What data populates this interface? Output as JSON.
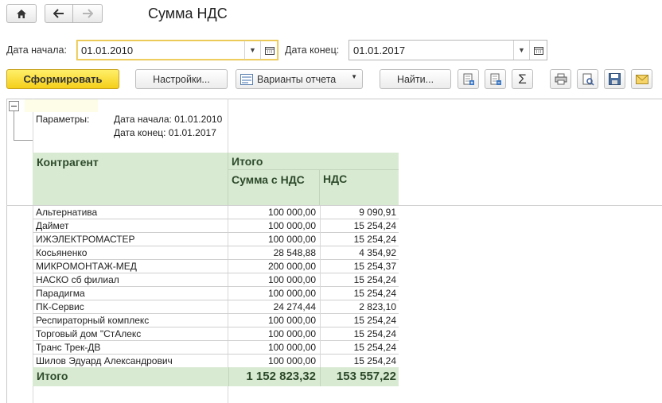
{
  "window": {
    "title": "Сумма НДС"
  },
  "nav": {
    "home_icon": "home-icon",
    "back_icon": "arrow-left-icon",
    "forward_icon": "arrow-right-icon"
  },
  "filters": {
    "start_label": "Дата начала:",
    "start_value": "01.01.2010",
    "end_label": "Дата конец:",
    "end_value": "01.01.2017"
  },
  "toolbar": {
    "generate_label": "Сформировать",
    "settings_label": "Настройки...",
    "variants_label": "Варианты отчета",
    "find_label": "Найти...",
    "sum_glyph": "Σ"
  },
  "report": {
    "params_label": "Параметры:",
    "param_start": "Дата начала: 01.01.2010",
    "param_end": "Дата конец: 01.01.2017",
    "col_contragent": "Контрагент",
    "col_total": "Итого",
    "col_sum": "Сумма с НДС",
    "col_vat": "НДС",
    "rows": [
      {
        "name": "Альтернатива",
        "sum": "100 000,00",
        "vat": "9 090,91"
      },
      {
        "name": "Даймет",
        "sum": "100 000,00",
        "vat": "15 254,24"
      },
      {
        "name": "ИЖЭЛЕКТРОМАСТЕР",
        "sum": "100 000,00",
        "vat": "15 254,24"
      },
      {
        "name": "Косьяненко",
        "sum": "28 548,88",
        "vat": "4 354,92"
      },
      {
        "name": "МИКРОМОНТАЖ-МЕД",
        "sum": "200 000,00",
        "vat": "15 254,37"
      },
      {
        "name": "НАСКО сб филиал",
        "sum": "100 000,00",
        "vat": "15 254,24"
      },
      {
        "name": "Парадигма",
        "sum": "100 000,00",
        "vat": "15 254,24"
      },
      {
        "name": "ПК-Сервис",
        "sum": "24 274,44",
        "vat": "2 823,10"
      },
      {
        "name": "Респираторный комплекс",
        "sum": "100 000,00",
        "vat": "15 254,24"
      },
      {
        "name": "Торговый дом \"СтАлекс",
        "sum": "100 000,00",
        "vat": "15 254,24"
      },
      {
        "name": "Транс Трек-ДВ",
        "sum": "100 000,00",
        "vat": "15 254,24"
      },
      {
        "name": "Шилов Эдуард Александрович",
        "sum": "100 000,00",
        "vat": "15 254,24"
      }
    ],
    "total_label": "Итого",
    "total_sum": "1 152 823,32",
    "total_vat": "153 557,22"
  },
  "colors": {
    "accent_yellow": "#f5cf1a",
    "header_green": "#d9ead3",
    "focus_border": "#e7c24a"
  }
}
